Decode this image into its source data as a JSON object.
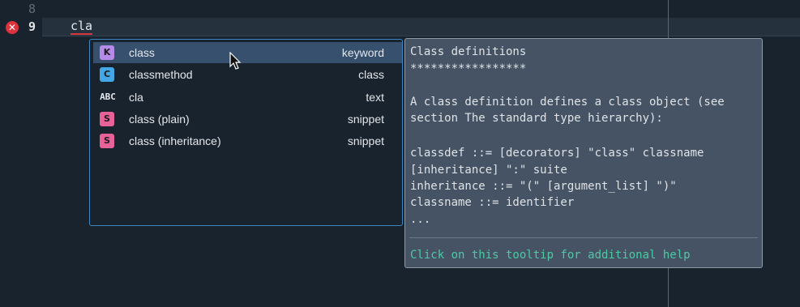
{
  "editor": {
    "line_numbers": [
      "8",
      "9"
    ],
    "current_line_text": "cla",
    "error_icon": "error-icon"
  },
  "completion": {
    "items": [
      {
        "icon": "keyword-icon",
        "icon_text": "K",
        "label": "class",
        "type": "keyword",
        "selected": true
      },
      {
        "icon": "class-icon",
        "icon_text": "C",
        "label": "classmethod",
        "type": "class",
        "selected": false
      },
      {
        "icon": "text-icon",
        "icon_text": "ABC",
        "label": "cla",
        "type": "text",
        "selected": false
      },
      {
        "icon": "snippet-icon",
        "icon_text": "S",
        "label": "class (plain)",
        "type": "snippet",
        "selected": false
      },
      {
        "icon": "snippet-icon",
        "icon_text": "S",
        "label": "class (inheritance)",
        "type": "snippet",
        "selected": false
      }
    ]
  },
  "tooltip": {
    "lines": [
      "Class definitions",
      "*****************",
      "",
      "A class definition defines a class object (see",
      "section The standard type hierarchy):",
      "",
      "classdef ::= [decorators] \"class\" classname",
      "[inheritance] \":\" suite",
      "inheritance ::= \"(\" [argument_list] \")\"",
      "classname ::= identifier",
      "..."
    ],
    "help_text": "Click on this tooltip for additional help"
  },
  "colors": {
    "background": "#19232d",
    "selection": "#37506d",
    "tooltip_bg": "#455364",
    "help_text": "#4ec9a4",
    "error": "#e0323c"
  }
}
